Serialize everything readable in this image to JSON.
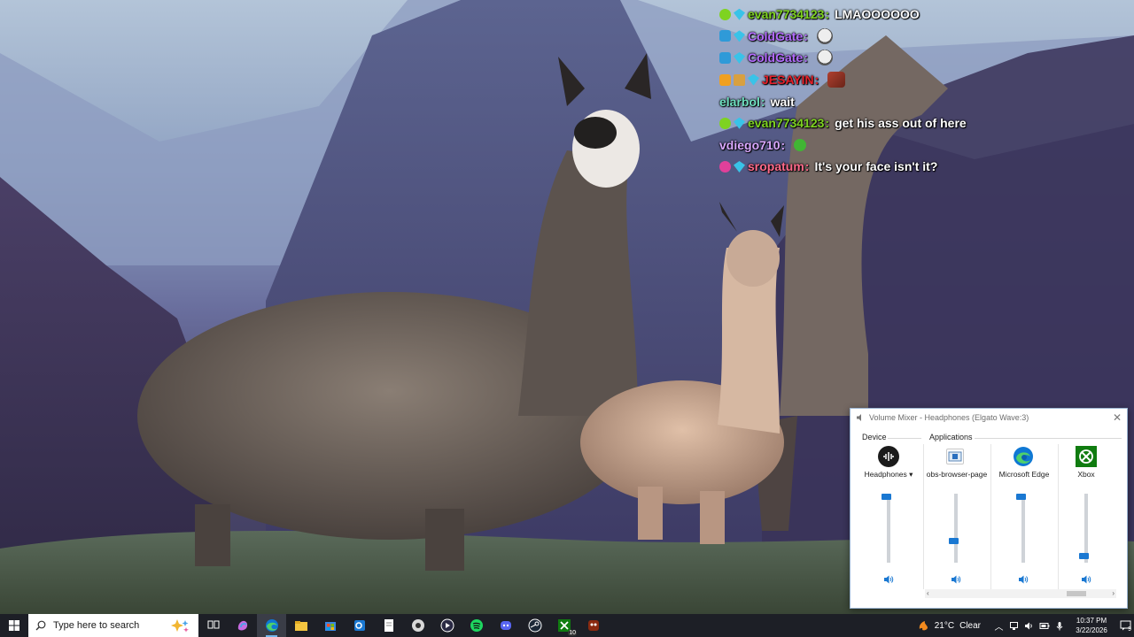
{
  "chat": {
    "messages": [
      {
        "user": "evan7734123",
        "user_color": "#7ed321",
        "sep": ":",
        "text": "LMAOOOOOO",
        "badges": [
          "green",
          "cyan"
        ],
        "emote": ""
      },
      {
        "user": "ColdGate",
        "user_color": "#b46cff",
        "sep": ":",
        "text": "",
        "badges": [
          "blue",
          "cyan"
        ],
        "emote": "skull"
      },
      {
        "user": "ColdGate",
        "user_color": "#b46cff",
        "sep": ":",
        "text": "",
        "badges": [
          "blue",
          "cyan"
        ],
        "emote": "skull"
      },
      {
        "user": "JESAYIN",
        "user_color": "#e5202a",
        "sep": ":",
        "text": "",
        "badges": [
          "gold",
          "tan",
          "cyan"
        ],
        "emote": "box"
      },
      {
        "user": "elarbol",
        "user_color": "#6fe0c0",
        "sep": ":",
        "text": "wait",
        "badges": [],
        "emote": ""
      },
      {
        "user": "evan7734123",
        "user_color": "#7ed321",
        "sep": ":",
        "text": "get his ass out of here",
        "badges": [
          "green",
          "cyan"
        ],
        "emote": ""
      },
      {
        "user": "vdiego710",
        "user_color": "#d9a8ff",
        "sep": ":",
        "text": "",
        "badges": [],
        "emote": "pepe"
      },
      {
        "user": "sropatum",
        "user_color": "#ff6a8a",
        "sep": ":",
        "text": "It's your face isn't it?",
        "badges": [
          "pink",
          "cyan"
        ],
        "emote": ""
      }
    ]
  },
  "mixer": {
    "title": "Volume Mixer - Headphones (Elgato Wave:3)",
    "device_label": "Device",
    "applications_label": "Applications",
    "device": {
      "name": "Headphones",
      "icon": "headphones-device-icon",
      "volume": 1.0
    },
    "apps": [
      {
        "name": "obs-browser-page",
        "icon": "obs-browser-page-icon",
        "volume": 0.3
      },
      {
        "name": "Microsoft Edge",
        "icon": "edge-icon",
        "volume": 1.0
      },
      {
        "name": "Xbox",
        "icon": "xbox-icon",
        "volume": 0.05
      }
    ]
  },
  "taskbar": {
    "search_placeholder": "Type here to search",
    "apps": [
      {
        "name": "task-view-icon",
        "active": false,
        "badge": ""
      },
      {
        "name": "copilot-icon",
        "active": false,
        "badge": ""
      },
      {
        "name": "edge-icon",
        "active": true,
        "badge": ""
      },
      {
        "name": "file-explorer-icon",
        "active": false,
        "badge": ""
      },
      {
        "name": "microsoft-store-icon",
        "active": false,
        "badge": ""
      },
      {
        "name": "outlook-icon",
        "active": false,
        "badge": ""
      },
      {
        "name": "notepad-icon",
        "active": false,
        "badge": ""
      },
      {
        "name": "obs-icon",
        "active": false,
        "badge": ""
      },
      {
        "name": "media-app-icon",
        "active": false,
        "badge": ""
      },
      {
        "name": "spotify-icon",
        "active": false,
        "badge": ""
      },
      {
        "name": "discord-icon",
        "active": false,
        "badge": ""
      },
      {
        "name": "steam-icon",
        "active": false,
        "badge": ""
      },
      {
        "name": "xbox-icon",
        "active": false,
        "badge": "10"
      },
      {
        "name": "game-icon",
        "active": false,
        "badge": ""
      }
    ],
    "weather": {
      "temp": "21°C",
      "condition": "Clear"
    },
    "clock": {
      "time": "10:37 PM",
      "date": "3/22/2026"
    },
    "notifications": "9"
  },
  "colors": {
    "taskbar_bg": "#1d1f26",
    "accent": "#1a78d2",
    "mixer_bg": "#ffffff"
  }
}
